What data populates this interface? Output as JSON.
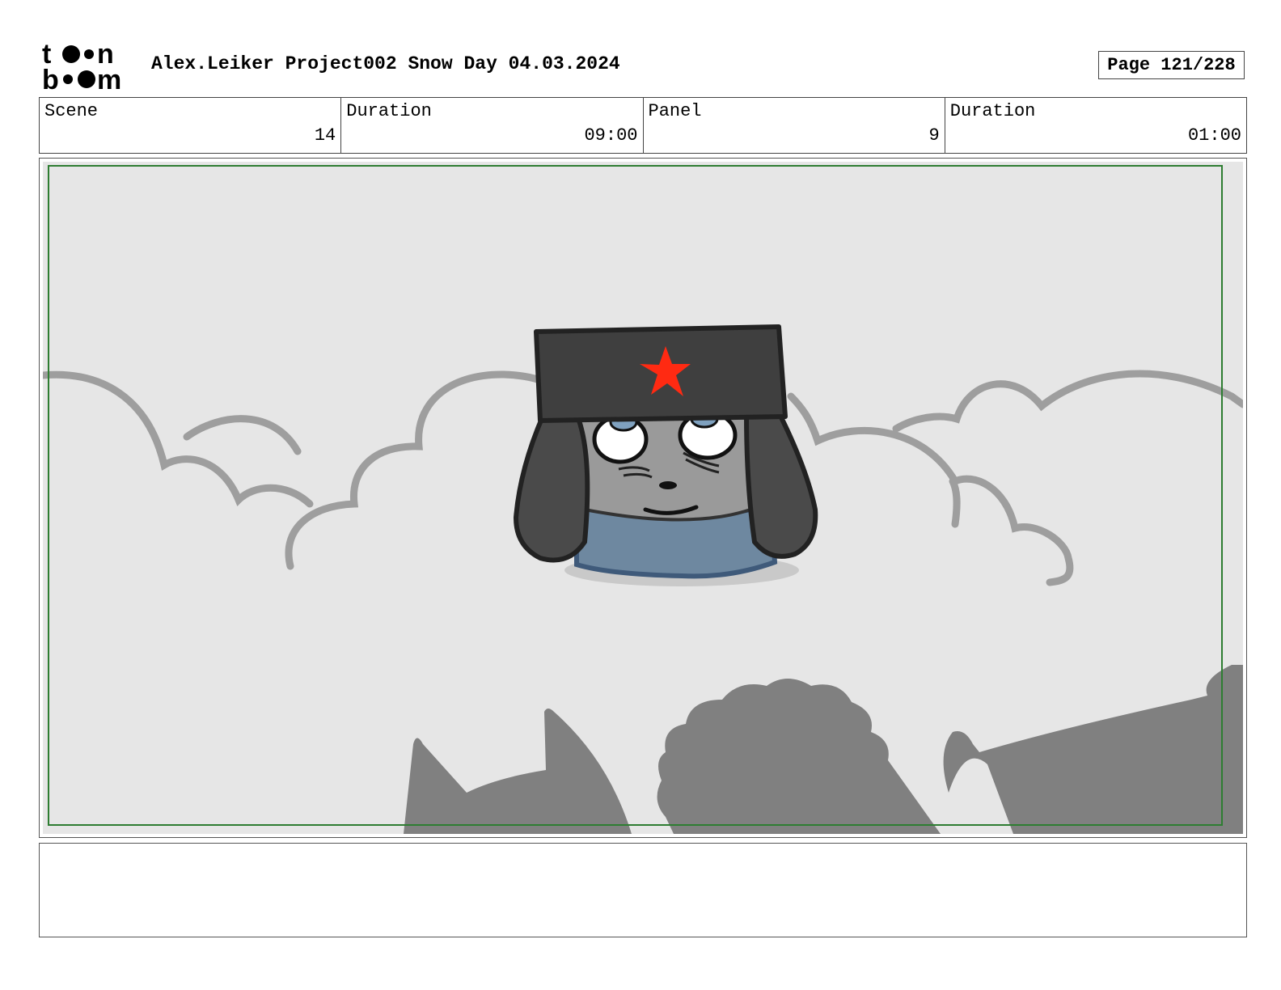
{
  "header": {
    "logo_name": "toon boom logo",
    "title": "Alex.Leiker Project002 Snow Day 04.03.2024",
    "page_label": "Page 121/228"
  },
  "info": {
    "scene_label": "Scene",
    "scene_value": "14",
    "scene_duration_label": "Duration",
    "scene_duration_value": "09:00",
    "panel_label": "Panel",
    "panel_value": "9",
    "panel_duration_label": "Duration",
    "panel_duration_value": "01:00"
  },
  "colors": {
    "safe_frame": "#2e7d32",
    "sky": "#e6e6e6",
    "cloud_line": "#9e9e9e",
    "silhouette": "#808080",
    "hat": "#3f3f3f",
    "star": "#ff2a12",
    "face": "#9a9a9a",
    "scarf": "#6e88a0"
  },
  "notes": {
    "text": ""
  }
}
